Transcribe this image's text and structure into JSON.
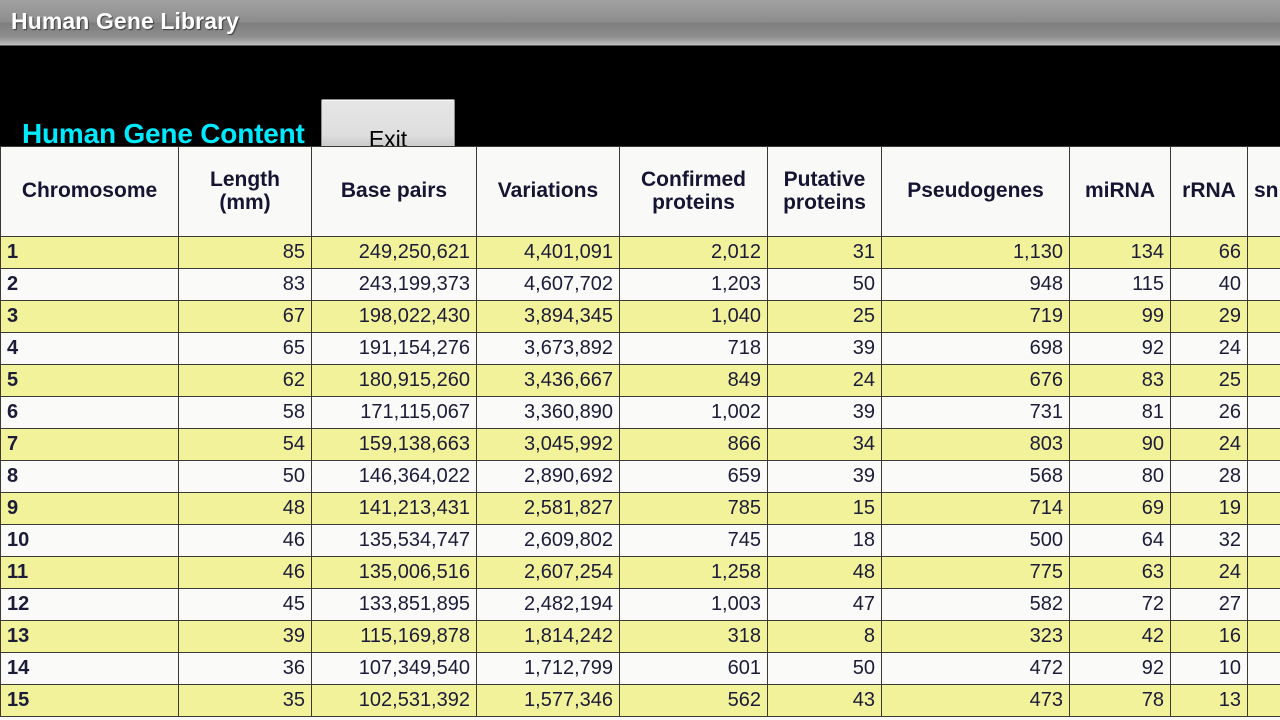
{
  "window": {
    "title": "Human Gene Library"
  },
  "toolbar": {
    "heading": "Human Gene Content",
    "exit_label": "Exit"
  },
  "colors": {
    "heading_cyan": "#00eaff",
    "row_highlight": "#f2f29a",
    "row_plain": "#fafaf8",
    "titlebar_text": "#ffffff",
    "background": "#000000",
    "grid_line": "#3a3a30",
    "cell_text": "#1b1b3a"
  },
  "table": {
    "headers": [
      "Chromosome",
      "Length\n(mm)",
      "Base pairs",
      "Variations",
      "Confirmed\nproteins",
      "Putative\nproteins",
      "Pseudogenes",
      "miRNA",
      "rRNA",
      "snRNA"
    ],
    "headers_line1": [
      "Chromosome",
      "Length",
      "Base pairs",
      "Variations",
      "Confirmed",
      "Putative",
      "Pseudogenes",
      "miRNA",
      "rRNA",
      "sn"
    ],
    "headers_line2": [
      "",
      "(mm)",
      "",
      "",
      "proteins",
      "proteins",
      "",
      "",
      "",
      ""
    ],
    "rows": [
      {
        "chromosome": "1",
        "length_mm": "85",
        "base_pairs": "249,250,621",
        "variations": "4,401,091",
        "confirmed_proteins": "2,012",
        "putative_proteins": "31",
        "pseudogenes": "1,130",
        "mirna": "134",
        "rrna": "66",
        "snrna": ""
      },
      {
        "chromosome": "2",
        "length_mm": "83",
        "base_pairs": "243,199,373",
        "variations": "4,607,702",
        "confirmed_proteins": "1,203",
        "putative_proteins": "50",
        "pseudogenes": "948",
        "mirna": "115",
        "rrna": "40",
        "snrna": ""
      },
      {
        "chromosome": "3",
        "length_mm": "67",
        "base_pairs": "198,022,430",
        "variations": "3,894,345",
        "confirmed_proteins": "1,040",
        "putative_proteins": "25",
        "pseudogenes": "719",
        "mirna": "99",
        "rrna": "29",
        "snrna": ""
      },
      {
        "chromosome": "4",
        "length_mm": "65",
        "base_pairs": "191,154,276",
        "variations": "3,673,892",
        "confirmed_proteins": "718",
        "putative_proteins": "39",
        "pseudogenes": "698",
        "mirna": "92",
        "rrna": "24",
        "snrna": ""
      },
      {
        "chromosome": "5",
        "length_mm": "62",
        "base_pairs": "180,915,260",
        "variations": "3,436,667",
        "confirmed_proteins": "849",
        "putative_proteins": "24",
        "pseudogenes": "676",
        "mirna": "83",
        "rrna": "25",
        "snrna": ""
      },
      {
        "chromosome": "6",
        "length_mm": "58",
        "base_pairs": "171,115,067",
        "variations": "3,360,890",
        "confirmed_proteins": "1,002",
        "putative_proteins": "39",
        "pseudogenes": "731",
        "mirna": "81",
        "rrna": "26",
        "snrna": ""
      },
      {
        "chromosome": "7",
        "length_mm": "54",
        "base_pairs": "159,138,663",
        "variations": "3,045,992",
        "confirmed_proteins": "866",
        "putative_proteins": "34",
        "pseudogenes": "803",
        "mirna": "90",
        "rrna": "24",
        "snrna": ""
      },
      {
        "chromosome": "8",
        "length_mm": "50",
        "base_pairs": "146,364,022",
        "variations": "2,890,692",
        "confirmed_proteins": "659",
        "putative_proteins": "39",
        "pseudogenes": "568",
        "mirna": "80",
        "rrna": "28",
        "snrna": ""
      },
      {
        "chromosome": "9",
        "length_mm": "48",
        "base_pairs": "141,213,431",
        "variations": "2,581,827",
        "confirmed_proteins": "785",
        "putative_proteins": "15",
        "pseudogenes": "714",
        "mirna": "69",
        "rrna": "19",
        "snrna": ""
      },
      {
        "chromosome": "10",
        "length_mm": "46",
        "base_pairs": "135,534,747",
        "variations": "2,609,802",
        "confirmed_proteins": "745",
        "putative_proteins": "18",
        "pseudogenes": "500",
        "mirna": "64",
        "rrna": "32",
        "snrna": ""
      },
      {
        "chromosome": "11",
        "length_mm": "46",
        "base_pairs": "135,006,516",
        "variations": "2,607,254",
        "confirmed_proteins": "1,258",
        "putative_proteins": "48",
        "pseudogenes": "775",
        "mirna": "63",
        "rrna": "24",
        "snrna": ""
      },
      {
        "chromosome": "12",
        "length_mm": "45",
        "base_pairs": "133,851,895",
        "variations": "2,482,194",
        "confirmed_proteins": "1,003",
        "putative_proteins": "47",
        "pseudogenes": "582",
        "mirna": "72",
        "rrna": "27",
        "snrna": ""
      },
      {
        "chromosome": "13",
        "length_mm": "39",
        "base_pairs": "115,169,878",
        "variations": "1,814,242",
        "confirmed_proteins": "318",
        "putative_proteins": "8",
        "pseudogenes": "323",
        "mirna": "42",
        "rrna": "16",
        "snrna": ""
      },
      {
        "chromosome": "14",
        "length_mm": "36",
        "base_pairs": "107,349,540",
        "variations": "1,712,799",
        "confirmed_proteins": "601",
        "putative_proteins": "50",
        "pseudogenes": "472",
        "mirna": "92",
        "rrna": "10",
        "snrna": ""
      },
      {
        "chromosome": "15",
        "length_mm": "35",
        "base_pairs": "102,531,392",
        "variations": "1,577,346",
        "confirmed_proteins": "562",
        "putative_proteins": "43",
        "pseudogenes": "473",
        "mirna": "78",
        "rrna": "13",
        "snrna": ""
      }
    ]
  }
}
